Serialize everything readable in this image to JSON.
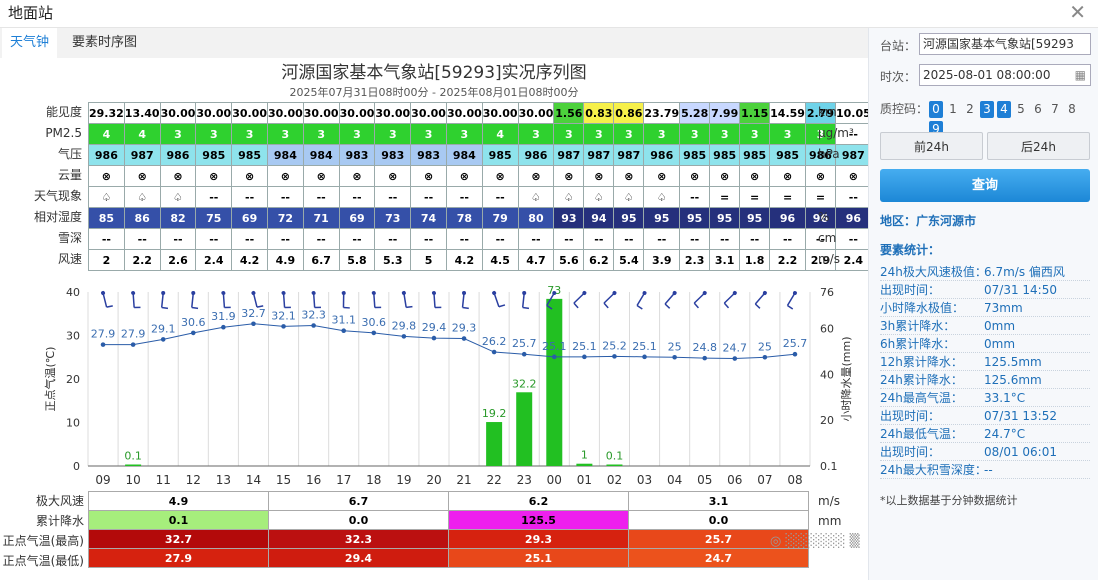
{
  "window": {
    "title": "地面站",
    "close_icon": "close-icon"
  },
  "tabs": [
    {
      "label": "天气钟",
      "active": true
    },
    {
      "label": "要素时序图",
      "active": false
    }
  ],
  "chart_title": "河源国家基本气象站[59293]实况序列图",
  "chart_subtitle": "2025年07月31日08时00分 - 2025年08月01日08时00分",
  "hours": [
    "09",
    "10",
    "11",
    "12",
    "13",
    "14",
    "15",
    "16",
    "17",
    "18",
    "19",
    "20",
    "21",
    "22",
    "23",
    "00",
    "01",
    "02",
    "03",
    "04",
    "05",
    "06",
    "07",
    "08"
  ],
  "grid": {
    "rows": [
      {
        "label": "能见度",
        "unit": "km",
        "values": [
          "29.32",
          "13.40",
          "30.00",
          "30.00",
          "30.00",
          "30.00",
          "30.00",
          "30.00",
          "30.00",
          "30.00",
          "30.00",
          "30.00",
          "30.00",
          "1.56",
          "0.83",
          "0.86",
          "23.79",
          "5.28",
          "7.99",
          "1.15",
          "14.59",
          "2.79",
          "10.05",
          "30.00"
        ],
        "colors": [
          "#fff",
          "#fff",
          "#fff",
          "#fff",
          "#fff",
          "#fff",
          "#fff",
          "#fff",
          "#fff",
          "#fff",
          "#fff",
          "#fff",
          "#fff",
          "#4cd13c",
          "#f6f04a",
          "#f6f04a",
          "#fff",
          "#c8d8ff",
          "#c8d8ff",
          "#4cd13c",
          "#fff",
          "#6fd3e9",
          "#fff",
          "#fff"
        ]
      },
      {
        "label": "PM2.5",
        "unit": "μg/m³",
        "values": [
          "4",
          "4",
          "3",
          "3",
          "3",
          "3",
          "3",
          "3",
          "3",
          "3",
          "3",
          "4",
          "3",
          "3",
          "3",
          "3",
          "3",
          "3",
          "3",
          "3",
          "3",
          "3",
          "--",
          "--"
        ],
        "colors": [
          "#2fd12f",
          "#2fd12f",
          "#2fd12f",
          "#2fd12f",
          "#2fd12f",
          "#2fd12f",
          "#2fd12f",
          "#2fd12f",
          "#2fd12f",
          "#2fd12f",
          "#2fd12f",
          "#2fd12f",
          "#2fd12f",
          "#2fd12f",
          "#2fd12f",
          "#2fd12f",
          "#2fd12f",
          "#2fd12f",
          "#2fd12f",
          "#2fd12f",
          "#2fd12f",
          "#2fd12f",
          "#fff",
          "#fff"
        ],
        "text_colors": [
          "#fff",
          "#fff",
          "#fff",
          "#fff",
          "#fff",
          "#fff",
          "#fff",
          "#fff",
          "#fff",
          "#fff",
          "#fff",
          "#fff",
          "#fff",
          "#fff",
          "#fff",
          "#fff",
          "#fff",
          "#fff",
          "#fff",
          "#fff",
          "#fff",
          "#fff",
          "#000",
          "#000"
        ]
      },
      {
        "label": "气压",
        "unit": "hPa",
        "values": [
          "986",
          "987",
          "986",
          "985",
          "985",
          "984",
          "984",
          "983",
          "983",
          "983",
          "984",
          "985",
          "986",
          "987",
          "987",
          "987",
          "986",
          "985",
          "985",
          "985",
          "985",
          "986",
          "987",
          "987"
        ],
        "colors": [
          "#8ee3ec",
          "#8ee3ec",
          "#8ee3ec",
          "#8ee3ec",
          "#8ee3ec",
          "#a8c9f2",
          "#a8c9f2",
          "#a8c9f2",
          "#a8c9f2",
          "#a8c9f2",
          "#a8c9f2",
          "#8ee3ec",
          "#8ee3ec",
          "#8ee3ec",
          "#8ee3ec",
          "#8ee3ec",
          "#8ee3ec",
          "#8ee3ec",
          "#8ee3ec",
          "#8ee3ec",
          "#8ee3ec",
          "#8ee3ec",
          "#8ee3ec",
          "#8ee3ec"
        ]
      },
      {
        "label": "云量",
        "unit": "",
        "values": [
          "⊗",
          "⊗",
          "⊗",
          "⊗",
          "⊗",
          "⊗",
          "⊗",
          "⊗",
          "⊗",
          "⊗",
          "⊗",
          "⊗",
          "⊗",
          "⊗",
          "⊗",
          "⊗",
          "⊗",
          "⊗",
          "⊗",
          "⊗",
          "⊗",
          "⊗",
          "⊗",
          "⊗"
        ]
      },
      {
        "label": "天气现象",
        "unit": "",
        "values": [
          "♤",
          "♤",
          "♤",
          "--",
          "--",
          "--",
          "--",
          "--",
          "--",
          "--",
          "--",
          "--",
          "♤",
          "♤",
          "♤",
          "♤",
          "♤",
          "--",
          "=",
          "=",
          "=",
          "=",
          "--",
          "--"
        ]
      },
      {
        "label": "相对湿度",
        "unit": "%",
        "values": [
          "85",
          "86",
          "82",
          "75",
          "69",
          "72",
          "71",
          "69",
          "73",
          "74",
          "78",
          "79",
          "80",
          "93",
          "94",
          "95",
          "95",
          "95",
          "95",
          "95",
          "96",
          "96",
          "96",
          "95"
        ],
        "colors": [
          "#3550a8",
          "#3550a8",
          "#3550a8",
          "#3550a8",
          "#3550a8",
          "#3550a8",
          "#3550a8",
          "#3550a8",
          "#3550a8",
          "#3550a8",
          "#3550a8",
          "#3550a8",
          "#3550a8",
          "#25307c",
          "#25307c",
          "#25307c",
          "#25307c",
          "#25307c",
          "#25307c",
          "#25307c",
          "#25307c",
          "#25307c",
          "#25307c",
          "#25307c"
        ],
        "text_colors": [
          "#fff",
          "#fff",
          "#fff",
          "#fff",
          "#fff",
          "#fff",
          "#fff",
          "#fff",
          "#fff",
          "#fff",
          "#fff",
          "#fff",
          "#fff",
          "#fff",
          "#fff",
          "#fff",
          "#fff",
          "#fff",
          "#fff",
          "#fff",
          "#fff",
          "#fff",
          "#fff",
          "#fff"
        ]
      },
      {
        "label": "雪深",
        "unit": "cm",
        "values": [
          "--",
          "--",
          "--",
          "--",
          "--",
          "--",
          "--",
          "--",
          "--",
          "--",
          "--",
          "--",
          "--",
          "--",
          "--",
          "--",
          "--",
          "--",
          "--",
          "--",
          "--",
          "--",
          "--",
          "--"
        ]
      },
      {
        "label": "风速",
        "unit": "m/s",
        "values": [
          "2",
          "2.2",
          "2.6",
          "2.4",
          "4.2",
          "4.9",
          "6.7",
          "5.8",
          "5.3",
          "5",
          "4.2",
          "4.5",
          "4.7",
          "5.6",
          "6.2",
          "5.4",
          "3.9",
          "2.3",
          "3.1",
          "1.8",
          "2.2",
          "2.9",
          "2.4",
          "1.4"
        ]
      }
    ]
  },
  "chart_data": {
    "type": "line",
    "x": [
      "09",
      "10",
      "11",
      "12",
      "13",
      "14",
      "15",
      "16",
      "17",
      "18",
      "19",
      "20",
      "21",
      "22",
      "23",
      "00",
      "01",
      "02",
      "03",
      "04",
      "05",
      "06",
      "07",
      "08"
    ],
    "ylabel_left": "正点气温(℃)",
    "ylabel_right": "小时降水量(mm)",
    "ylim_left": [
      0,
      40
    ],
    "yticks_left": [
      "0",
      "10",
      "20",
      "30",
      "40"
    ],
    "yticks_right": [
      "0.1",
      "20",
      "40",
      "60",
      "76"
    ],
    "ylim_right": [
      0,
      76
    ],
    "series": [
      {
        "type": "line",
        "values": [
          27.9,
          27.9,
          29.1,
          30.6,
          31.9,
          32.7,
          32.1,
          32.3,
          31.1,
          30.6,
          29.8,
          29.4,
          29.3,
          26.2,
          25.7,
          25.1,
          25.1,
          25.2,
          25.1,
          25,
          24.8,
          24.7,
          25,
          25.7
        ],
        "color": "#2a5ca8"
      },
      {
        "type": "bar",
        "values": [
          null,
          0.1,
          null,
          null,
          null,
          null,
          null,
          null,
          null,
          null,
          null,
          null,
          null,
          19.2,
          32.2,
          73,
          1,
          0.1,
          null,
          null,
          null,
          null,
          null,
          null
        ],
        "color": "#22c022"
      }
    ]
  },
  "bottom": {
    "rows": [
      {
        "label": "极大风速",
        "unit": "m/s",
        "values": [
          "4.9",
          "6.7",
          "6.2",
          "3.1"
        ],
        "colors": [
          "#fff",
          "#fff",
          "#fff",
          "#fff"
        ],
        "text_colors": [
          "#000",
          "#000",
          "#000",
          "#000"
        ]
      },
      {
        "label": "累计降水",
        "unit": "mm",
        "values": [
          "0.1",
          "0.0",
          "125.5",
          "0.0"
        ],
        "colors": [
          "#a6ee7c",
          "#fff",
          "#ee1fee",
          "#fff"
        ],
        "text_colors": [
          "#000",
          "#000",
          "#000",
          "#000"
        ]
      },
      {
        "label": "正点气温(最高)",
        "unit": "",
        "values": [
          "32.7",
          "32.3",
          "29.3",
          "25.7"
        ],
        "colors": [
          "#b30a0a",
          "#bb1010",
          "#d6220f",
          "#e8481a"
        ],
        "text_colors": [
          "#fff",
          "#fff",
          "#fff",
          "#fff"
        ]
      },
      {
        "label": "正点气温(最低)",
        "unit": "",
        "values": [
          "27.9",
          "29.4",
          "25.1",
          "24.7"
        ],
        "colors": [
          "#d6220f",
          "#cf1c0f",
          "#e8481a",
          "#ec521c"
        ],
        "text_colors": [
          "#fff",
          "#fff",
          "#fff",
          "#fff"
        ]
      }
    ]
  },
  "side": {
    "station_label": "台站：",
    "station_value": "河源国家基本气象站[59293",
    "time_label": "时次：",
    "time_value": "2025-08-01 08:00:00",
    "qc_label": "质控码：",
    "qc_codes": [
      {
        "v": "0",
        "on": true
      },
      {
        "v": "1",
        "on": false
      },
      {
        "v": "2",
        "on": false
      },
      {
        "v": "3",
        "on": true
      },
      {
        "v": "4",
        "on": true
      },
      {
        "v": "5",
        "on": false
      },
      {
        "v": "6",
        "on": false
      },
      {
        "v": "7",
        "on": false
      },
      {
        "v": "8",
        "on": false
      },
      {
        "v": "9",
        "on": true
      }
    ],
    "prev_btn": "前24h",
    "next_btn": "后24h",
    "query_btn": "查询",
    "region": "地区：广东河源市",
    "stats_head": "要素统计：",
    "stats": [
      {
        "k": "24h极大风速极值：",
        "v": "6.7m/s 偏西风"
      },
      {
        "k": "出现时间：",
        "v": "07/31 14:50"
      },
      {
        "k": "小时降水极值：",
        "v": "73mm"
      },
      {
        "k": "3h累计降水：",
        "v": "0mm"
      },
      {
        "k": "6h累计降水：",
        "v": "0mm"
      },
      {
        "k": "12h累计降水：",
        "v": "125.5mm"
      },
      {
        "k": "24h累计降水：",
        "v": "125.6mm"
      },
      {
        "k": "24h最高气温：",
        "v": "33.1°C"
      },
      {
        "k": "出现时间：",
        "v": "07/31 13:52"
      },
      {
        "k": "24h最低气温：",
        "v": "24.7°C"
      },
      {
        "k": "出现时间：",
        "v": "08/01 06:01"
      },
      {
        "k": "24h最大积雪深度：",
        "v": "--"
      }
    ],
    "note": "*以上数据基于分钟数据统计"
  }
}
